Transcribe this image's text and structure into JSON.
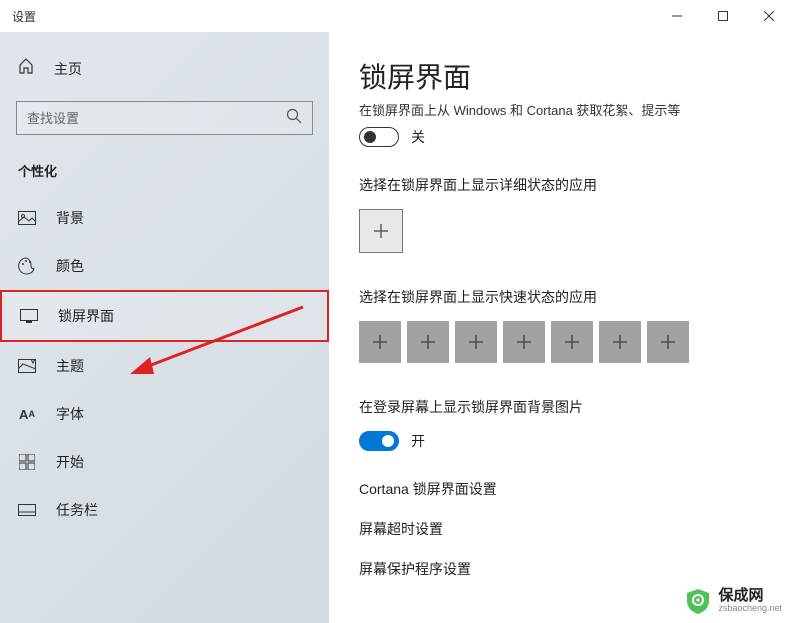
{
  "window": {
    "title": "设置"
  },
  "sidebar": {
    "home_label": "主页",
    "search_placeholder": "查找设置",
    "section_header": "个性化",
    "items": [
      {
        "label": "背景"
      },
      {
        "label": "颜色"
      },
      {
        "label": "锁屏界面"
      },
      {
        "label": "主题"
      },
      {
        "label": "字体"
      },
      {
        "label": "开始"
      },
      {
        "label": "任务栏"
      }
    ]
  },
  "main": {
    "title": "锁屏界面",
    "cortana_tip": "在锁屏界面上从 Windows 和 Cortana 获取花絮、提示等",
    "toggle_off": "关",
    "section_detailed": "选择在锁屏界面上显示详细状态的应用",
    "section_quick": "选择在锁屏界面上显示快速状态的应用",
    "section_login_bg": "在登录屏幕上显示锁屏界面背景图片",
    "toggle_on": "开",
    "link_cortana": "Cortana 锁屏界面设置",
    "link_timeout": "屏幕超时设置",
    "link_saver": "屏幕保护程序设置"
  },
  "watermark": {
    "name": "保成网",
    "url": "zsbaocheng.net"
  }
}
